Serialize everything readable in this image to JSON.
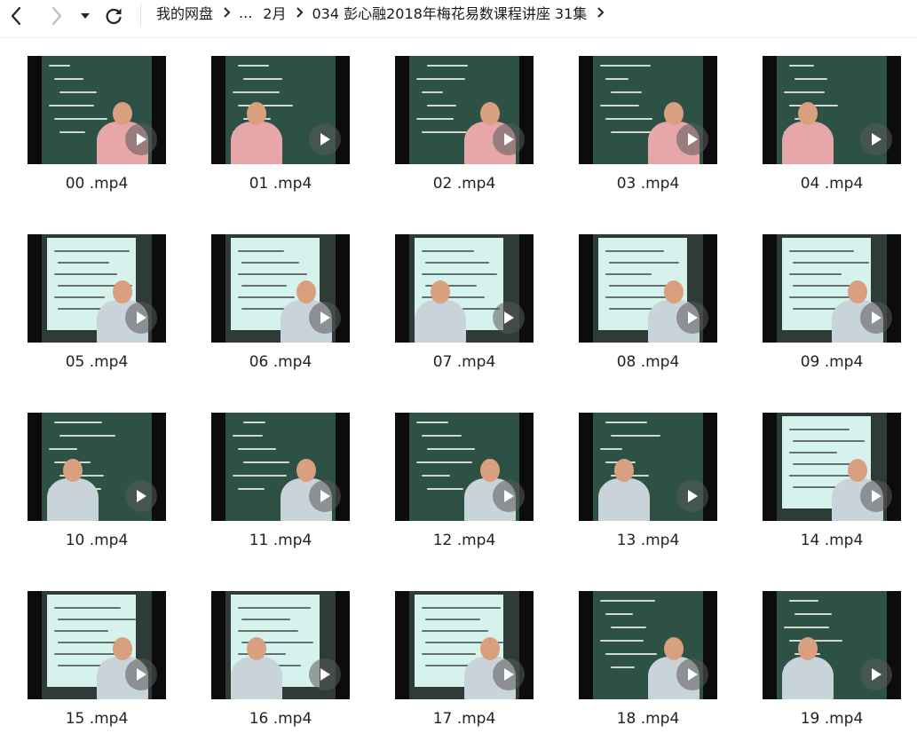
{
  "toolbar": {
    "back_icon": "chevron-left",
    "forward_icon": "chevron-right",
    "history_icon": "caret-down",
    "refresh_icon": "refresh"
  },
  "breadcrumb": [
    "我的网盘",
    "...",
    "2月",
    "034 彭心融2018年梅花易数课程讲座 31集"
  ],
  "files": [
    {
      "name": "00 .mp4",
      "kind": "board"
    },
    {
      "name": "01 .mp4",
      "kind": "board"
    },
    {
      "name": "02 .mp4",
      "kind": "board"
    },
    {
      "name": "03 .mp4",
      "kind": "board"
    },
    {
      "name": "04 .mp4",
      "kind": "board"
    },
    {
      "name": "05 .mp4",
      "kind": "projection"
    },
    {
      "name": "06 .mp4",
      "kind": "projection"
    },
    {
      "name": "07 .mp4",
      "kind": "projection"
    },
    {
      "name": "08 .mp4",
      "kind": "projection"
    },
    {
      "name": "09 .mp4",
      "kind": "projection"
    },
    {
      "name": "10 .mp4",
      "kind": "board"
    },
    {
      "name": "11 .mp4",
      "kind": "board"
    },
    {
      "name": "12 .mp4",
      "kind": "board"
    },
    {
      "name": "13 .mp4",
      "kind": "board"
    },
    {
      "name": "14 .mp4",
      "kind": "projection"
    },
    {
      "name": "15 .mp4",
      "kind": "projection"
    },
    {
      "name": "16 .mp4",
      "kind": "projection"
    },
    {
      "name": "17 .mp4",
      "kind": "projection"
    },
    {
      "name": "18 .mp4",
      "kind": "board"
    },
    {
      "name": "19 .mp4",
      "kind": "board"
    }
  ]
}
